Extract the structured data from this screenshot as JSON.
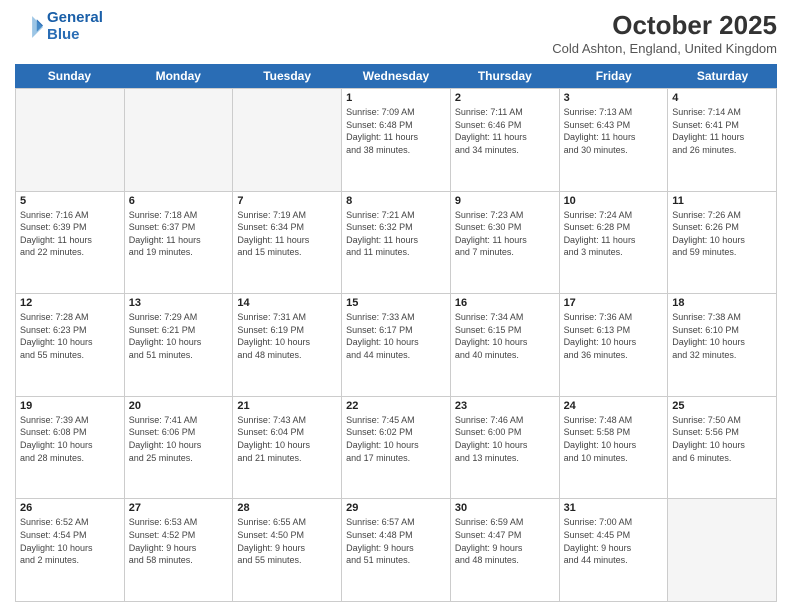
{
  "header": {
    "logo_line1": "General",
    "logo_line2": "Blue",
    "month_title": "October 2025",
    "location": "Cold Ashton, England, United Kingdom"
  },
  "days_of_week": [
    "Sunday",
    "Monday",
    "Tuesday",
    "Wednesday",
    "Thursday",
    "Friday",
    "Saturday"
  ],
  "rows": [
    [
      {
        "day": "",
        "info": ""
      },
      {
        "day": "",
        "info": ""
      },
      {
        "day": "",
        "info": ""
      },
      {
        "day": "1",
        "info": "Sunrise: 7:09 AM\nSunset: 6:48 PM\nDaylight: 11 hours\nand 38 minutes."
      },
      {
        "day": "2",
        "info": "Sunrise: 7:11 AM\nSunset: 6:46 PM\nDaylight: 11 hours\nand 34 minutes."
      },
      {
        "day": "3",
        "info": "Sunrise: 7:13 AM\nSunset: 6:43 PM\nDaylight: 11 hours\nand 30 minutes."
      },
      {
        "day": "4",
        "info": "Sunrise: 7:14 AM\nSunset: 6:41 PM\nDaylight: 11 hours\nand 26 minutes."
      }
    ],
    [
      {
        "day": "5",
        "info": "Sunrise: 7:16 AM\nSunset: 6:39 PM\nDaylight: 11 hours\nand 22 minutes."
      },
      {
        "day": "6",
        "info": "Sunrise: 7:18 AM\nSunset: 6:37 PM\nDaylight: 11 hours\nand 19 minutes."
      },
      {
        "day": "7",
        "info": "Sunrise: 7:19 AM\nSunset: 6:34 PM\nDaylight: 11 hours\nand 15 minutes."
      },
      {
        "day": "8",
        "info": "Sunrise: 7:21 AM\nSunset: 6:32 PM\nDaylight: 11 hours\nand 11 minutes."
      },
      {
        "day": "9",
        "info": "Sunrise: 7:23 AM\nSunset: 6:30 PM\nDaylight: 11 hours\nand 7 minutes."
      },
      {
        "day": "10",
        "info": "Sunrise: 7:24 AM\nSunset: 6:28 PM\nDaylight: 11 hours\nand 3 minutes."
      },
      {
        "day": "11",
        "info": "Sunrise: 7:26 AM\nSunset: 6:26 PM\nDaylight: 10 hours\nand 59 minutes."
      }
    ],
    [
      {
        "day": "12",
        "info": "Sunrise: 7:28 AM\nSunset: 6:23 PM\nDaylight: 10 hours\nand 55 minutes."
      },
      {
        "day": "13",
        "info": "Sunrise: 7:29 AM\nSunset: 6:21 PM\nDaylight: 10 hours\nand 51 minutes."
      },
      {
        "day": "14",
        "info": "Sunrise: 7:31 AM\nSunset: 6:19 PM\nDaylight: 10 hours\nand 48 minutes."
      },
      {
        "day": "15",
        "info": "Sunrise: 7:33 AM\nSunset: 6:17 PM\nDaylight: 10 hours\nand 44 minutes."
      },
      {
        "day": "16",
        "info": "Sunrise: 7:34 AM\nSunset: 6:15 PM\nDaylight: 10 hours\nand 40 minutes."
      },
      {
        "day": "17",
        "info": "Sunrise: 7:36 AM\nSunset: 6:13 PM\nDaylight: 10 hours\nand 36 minutes."
      },
      {
        "day": "18",
        "info": "Sunrise: 7:38 AM\nSunset: 6:10 PM\nDaylight: 10 hours\nand 32 minutes."
      }
    ],
    [
      {
        "day": "19",
        "info": "Sunrise: 7:39 AM\nSunset: 6:08 PM\nDaylight: 10 hours\nand 28 minutes."
      },
      {
        "day": "20",
        "info": "Sunrise: 7:41 AM\nSunset: 6:06 PM\nDaylight: 10 hours\nand 25 minutes."
      },
      {
        "day": "21",
        "info": "Sunrise: 7:43 AM\nSunset: 6:04 PM\nDaylight: 10 hours\nand 21 minutes."
      },
      {
        "day": "22",
        "info": "Sunrise: 7:45 AM\nSunset: 6:02 PM\nDaylight: 10 hours\nand 17 minutes."
      },
      {
        "day": "23",
        "info": "Sunrise: 7:46 AM\nSunset: 6:00 PM\nDaylight: 10 hours\nand 13 minutes."
      },
      {
        "day": "24",
        "info": "Sunrise: 7:48 AM\nSunset: 5:58 PM\nDaylight: 10 hours\nand 10 minutes."
      },
      {
        "day": "25",
        "info": "Sunrise: 7:50 AM\nSunset: 5:56 PM\nDaylight: 10 hours\nand 6 minutes."
      }
    ],
    [
      {
        "day": "26",
        "info": "Sunrise: 6:52 AM\nSunset: 4:54 PM\nDaylight: 10 hours\nand 2 minutes."
      },
      {
        "day": "27",
        "info": "Sunrise: 6:53 AM\nSunset: 4:52 PM\nDaylight: 9 hours\nand 58 minutes."
      },
      {
        "day": "28",
        "info": "Sunrise: 6:55 AM\nSunset: 4:50 PM\nDaylight: 9 hours\nand 55 minutes."
      },
      {
        "day": "29",
        "info": "Sunrise: 6:57 AM\nSunset: 4:48 PM\nDaylight: 9 hours\nand 51 minutes."
      },
      {
        "day": "30",
        "info": "Sunrise: 6:59 AM\nSunset: 4:47 PM\nDaylight: 9 hours\nand 48 minutes."
      },
      {
        "day": "31",
        "info": "Sunrise: 7:00 AM\nSunset: 4:45 PM\nDaylight: 9 hours\nand 44 minutes."
      },
      {
        "day": "",
        "info": ""
      }
    ]
  ]
}
